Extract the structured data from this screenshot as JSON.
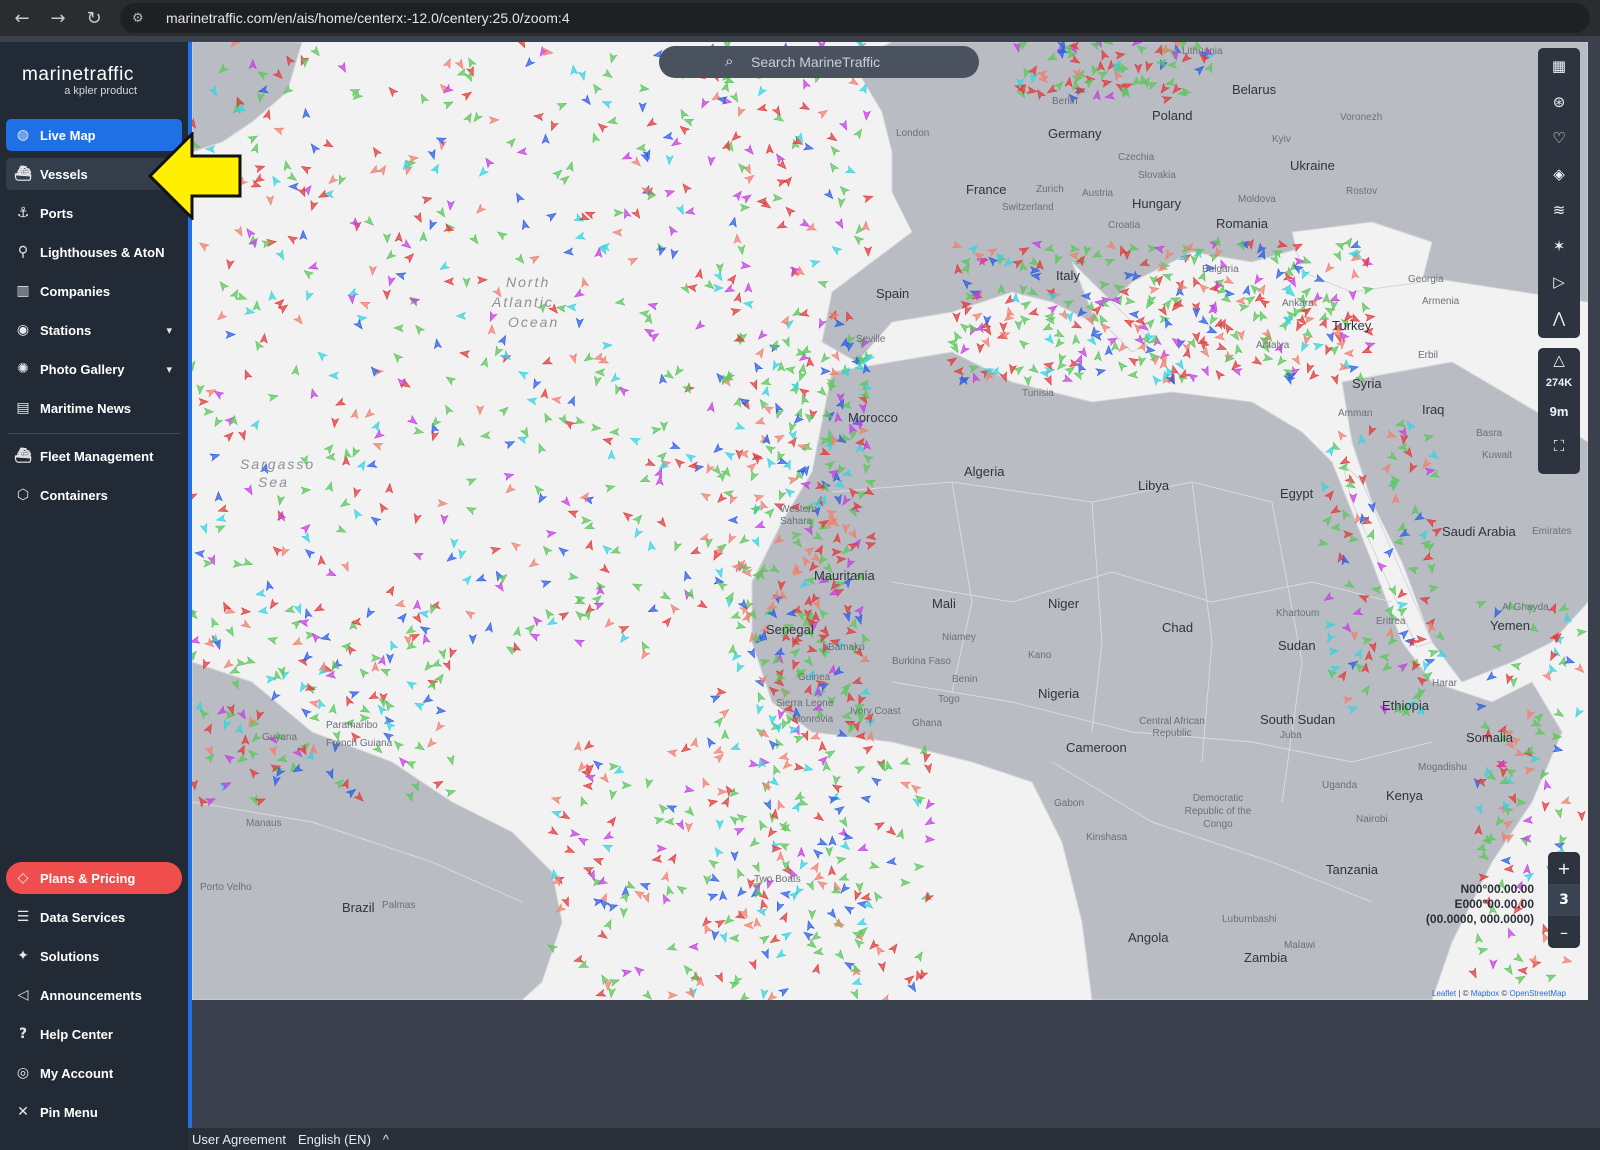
{
  "browser": {
    "back_icon": "arrow-left-icon",
    "forward_icon": "arrow-right-icon",
    "reload_icon": "reload-icon",
    "url": "marinetraffic.com/en/ais/home/centerx:-12.0/centery:25.0/zoom:4"
  },
  "brand": {
    "name": "marinetraffic",
    "sub": "a kpler product"
  },
  "sidebar": {
    "items": [
      {
        "label": "Live Map",
        "icon": "globe-icon"
      },
      {
        "label": "Vessels",
        "icon": "ship-icon"
      },
      {
        "label": "Ports",
        "icon": "anchor-icon"
      },
      {
        "label": "Lighthouses & AtoN",
        "icon": "lighthouse-icon"
      },
      {
        "label": "Companies",
        "icon": "building-icon"
      },
      {
        "label": "Stations",
        "icon": "antenna-icon"
      },
      {
        "label": "Photo Gallery",
        "icon": "camera-icon"
      },
      {
        "label": "Maritime News",
        "icon": "newspaper-icon"
      },
      {
        "label": "Fleet Management",
        "icon": "fleet-icon"
      },
      {
        "label": "Containers",
        "icon": "container-icon"
      }
    ],
    "bottom_items": [
      {
        "label": "Plans & Pricing",
        "icon": "tag-icon"
      },
      {
        "label": "Data Services",
        "icon": "database-icon"
      },
      {
        "label": "Solutions",
        "icon": "sparkle-icon"
      },
      {
        "label": "Announcements",
        "icon": "megaphone-icon"
      },
      {
        "label": "Help Center",
        "icon": "help-icon"
      },
      {
        "label": "My Account",
        "icon": "account-icon"
      },
      {
        "label": "Pin Menu",
        "icon": "pin-icon"
      }
    ]
  },
  "map": {
    "search_placeholder": "Search MarineTraffic",
    "sea_labels": [
      "North",
      "Atlantic",
      "Ocean",
      "Sargasso",
      "Sea"
    ],
    "countries": [
      "Belarus",
      "Poland",
      "Germany",
      "France",
      "Ukraine",
      "Romania",
      "Hungary",
      "Spain",
      "Italy",
      "Turkey",
      "Syria",
      "Iraq",
      "Morocco",
      "Algeria",
      "Libya",
      "Egypt",
      "Saudi Arabia",
      "Western Sahara",
      "Mauritania",
      "Mali",
      "Niger",
      "Chad",
      "Sudan",
      "Senegal",
      "Nigeria",
      "Ethiopia",
      "South Sudan",
      "Yemen",
      "Somalia",
      "Cameroon",
      "Kenya",
      "Tanzania",
      "Angola",
      "Zambia",
      "Brazil",
      "Guyana",
      "Democratic Republic of the Congo",
      "Central African Republic",
      "Burkina Faso",
      "Guinea",
      "Ghana",
      "Eritrea",
      "Uganda",
      "Gabon",
      "Tunisia"
    ],
    "cities": [
      "Lithuania",
      "Berlin",
      "London",
      "Czechia",
      "Slovakia",
      "Austria",
      "Zurich",
      "Switzerland",
      "Croatia",
      "Moldova",
      "Kyiv",
      "Voronezh",
      "Rostov",
      "Bulgaria",
      "Georgia",
      "Armenia",
      "Ankara",
      "Antalya",
      "Seville",
      "Khartoum",
      "Niamey",
      "Bamako",
      "Kinshasa",
      "Nairobi",
      "Mogadishu",
      "Juba",
      "Lubumbashi",
      "Malawi",
      "Kano",
      "Benin",
      "Togo",
      "Monrovia",
      "Sierra Leone",
      "Ivory Coast",
      "Two Boats",
      "Palmas",
      "Paramaribo",
      "French Guiana",
      "Manaus",
      "Porto Velho",
      "Harar",
      "Amman",
      "Erbil",
      "Basra",
      "Kuwait",
      "Emirates",
      "Al Ghayda"
    ],
    "toolbar_icons": [
      "map-icon",
      "filter-icon",
      "heart-icon",
      "layers-icon",
      "wind-icon",
      "weather-icon",
      "play-icon",
      "measure-icon"
    ],
    "vessel_count": "274K",
    "time_filter": "9m",
    "fullscreen_icon": "fullscreen-icon",
    "zoom_level": "3",
    "zoom_in": "+",
    "zoom_out": "–",
    "coords": [
      "N00°00.00.00",
      "E000°00.00.00",
      "(00.0000, 000.0000)"
    ],
    "attribution_a": "Leaflet",
    "attribution_b": " | © ",
    "attribution_c": "Mapbox",
    "attribution_d": " © ",
    "attribution_e": "OpenStreetMap"
  },
  "footer": {
    "agreement": "User Agreement",
    "language": "English (EN)",
    "toggle": "^"
  },
  "colors": {
    "active": "#1f6fe5",
    "pricing": "#f04d4d",
    "sidebar_bg": "#222a35",
    "cargo": "#5cc75c",
    "tanker": "#e03b3b",
    "passenger": "#2c5ee6",
    "pleasure": "#c440e0",
    "fishing": "#f08070",
    "tug": "#38d3e0"
  }
}
